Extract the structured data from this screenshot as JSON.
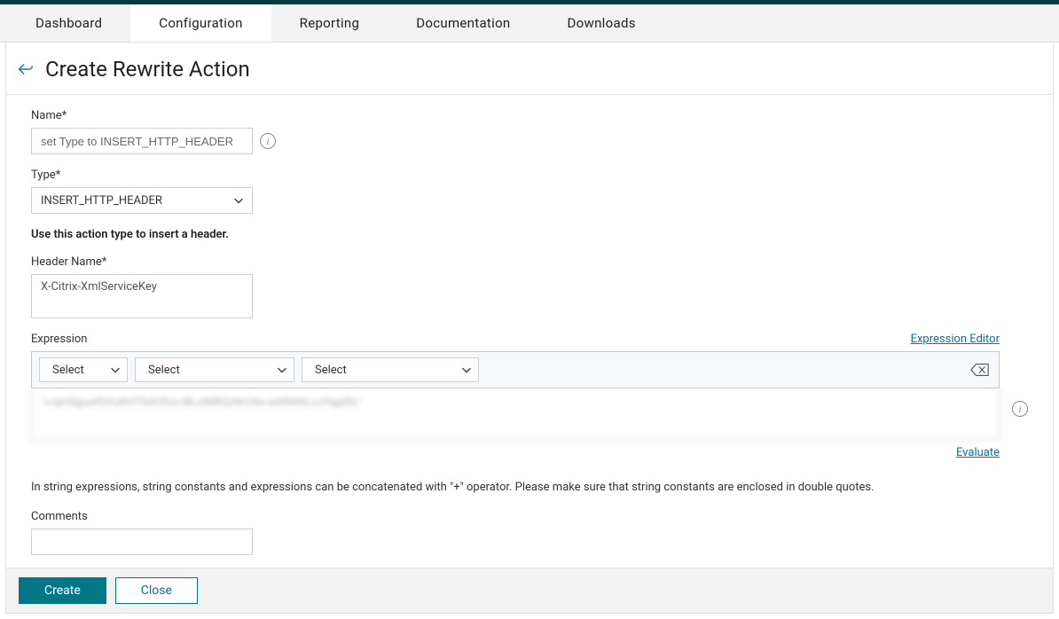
{
  "tabs": {
    "dashboard": "Dashboard",
    "configuration": "Configuration",
    "reporting": "Reporting",
    "documentation": "Documentation",
    "downloads": "Downloads"
  },
  "page": {
    "title": "Create Rewrite Action"
  },
  "form": {
    "name_label": "Name*",
    "name_value": "set Type to INSERT_HTTP_HEADER",
    "type_label": "Type*",
    "type_value": "INSERT_HTTP_HEADER",
    "type_hint": "Use this action type to insert a header.",
    "header_name_label": "Header Name*",
    "header_name_value": "X-Citrix-XmlServiceKey",
    "expression_label": "Expression",
    "expression_editor_link": "Expression Editor",
    "expr_select1": "Select",
    "expr_select2": "Select",
    "expr_select3": "Select",
    "expr_textarea_value": "\"u-tpHSjpuefUVuKHTSeh2fus-iBLoIMKQzNr24w-aAtfehKLzJYagd5c\"",
    "evaluate_link": "Evaluate",
    "concat_hint": "In string expressions, string constants and expressions can be concatenated with \"+\" operator. Please make sure that string constants are enclosed in double quotes.",
    "comments_label": "Comments"
  },
  "buttons": {
    "create": "Create",
    "close": "Close"
  }
}
